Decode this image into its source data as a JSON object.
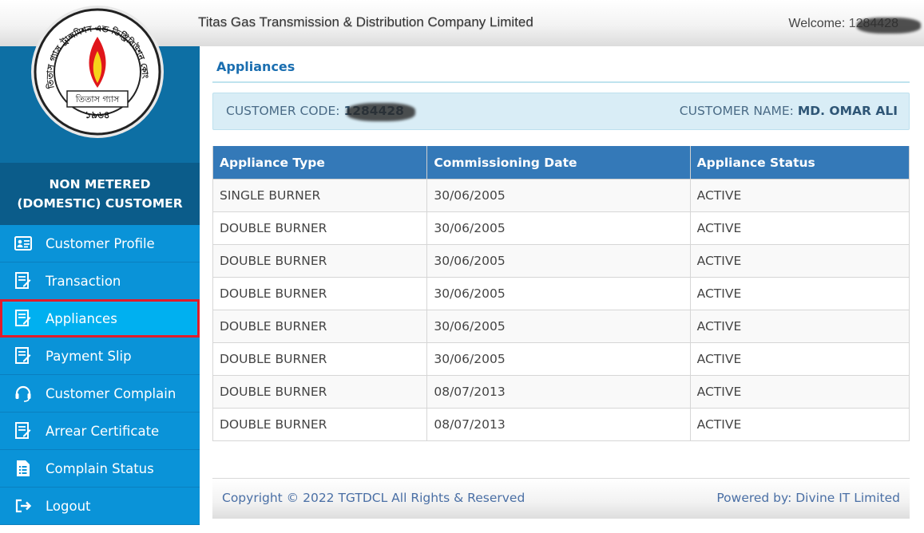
{
  "header": {
    "company_title": "Titas Gas Transmission & Distribution Company Limited",
    "welcome_label": "Welcome: ",
    "user_id": "1284428"
  },
  "logo": {
    "org_arc_text": "তিতাস গ্যাস ট্রান্সমিশন এন্ড ডিস্ট্রিবিউশন কোং লিঃ",
    "plaque_text": "তিতাস গ্যাস",
    "year_text": "১৯৬৪"
  },
  "sidebar": {
    "customer_type": "NON METERED (DOMESTIC) CUSTOMER",
    "items": [
      {
        "label": "Customer Profile",
        "icon": "id-card-icon"
      },
      {
        "label": "Transaction",
        "icon": "edit-document-icon"
      },
      {
        "label": "Appliances",
        "icon": "edit-document-icon",
        "active": true
      },
      {
        "label": "Payment Slip",
        "icon": "edit-document-icon"
      },
      {
        "label": "Customer Complain",
        "icon": "headset-icon"
      },
      {
        "label": "Arrear Certificate",
        "icon": "edit-document-icon"
      },
      {
        "label": "Complain Status",
        "icon": "list-document-icon"
      },
      {
        "label": "Logout",
        "icon": "logout-icon"
      }
    ]
  },
  "main": {
    "page_title": "Appliances",
    "customer_code_label": "CUSTOMER CODE: ",
    "customer_code": "1284428",
    "customer_name_label": "CUSTOMER NAME: ",
    "customer_name": "MD. OMAR ALI",
    "table": {
      "headers": [
        "Appliance Type",
        "Commissioning Date",
        "Appliance Status"
      ],
      "rows": [
        [
          "SINGLE BURNER",
          "30/06/2005",
          "ACTIVE"
        ],
        [
          "DOUBLE BURNER",
          "30/06/2005",
          "ACTIVE"
        ],
        [
          "DOUBLE BURNER",
          "30/06/2005",
          "ACTIVE"
        ],
        [
          "DOUBLE BURNER",
          "30/06/2005",
          "ACTIVE"
        ],
        [
          "DOUBLE BURNER",
          "30/06/2005",
          "ACTIVE"
        ],
        [
          "DOUBLE BURNER",
          "30/06/2005",
          "ACTIVE"
        ],
        [
          "DOUBLE BURNER",
          "08/07/2013",
          "ACTIVE"
        ],
        [
          "DOUBLE BURNER",
          "08/07/2013",
          "ACTIVE"
        ]
      ]
    }
  },
  "footer": {
    "copyright": "Copyright © 2022 TGTDCL All Rights & Reserved",
    "powered_by": "Powered by: Divine IT Limited"
  },
  "colors": {
    "sidebar_bg": "#0a93d8",
    "sidebar_active": "#00b0f0",
    "active_outline": "#e21c2a",
    "table_header": "#3479b8",
    "title_blue": "#1a6eb0"
  }
}
